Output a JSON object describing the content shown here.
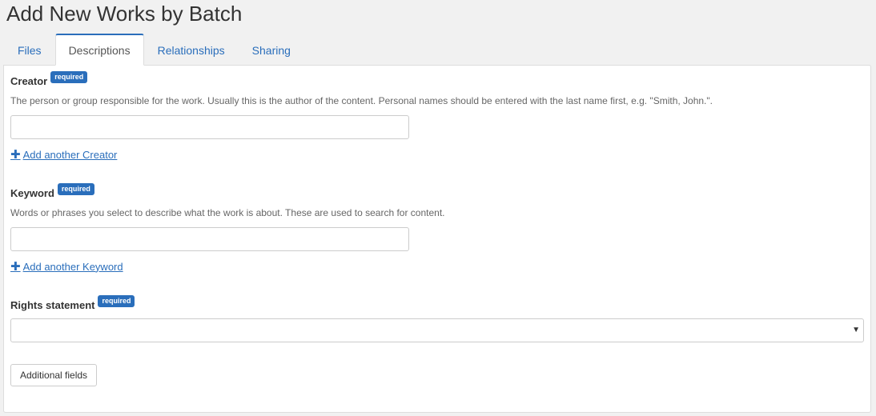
{
  "page": {
    "title": "Add New Works by Batch"
  },
  "tabs": [
    {
      "label": "Files",
      "active": false
    },
    {
      "label": "Descriptions",
      "active": true
    },
    {
      "label": "Relationships",
      "active": false
    },
    {
      "label": "Sharing",
      "active": false
    }
  ],
  "form": {
    "required_badge": "required",
    "creator": {
      "label": "Creator",
      "help": "The person or group responsible for the work. Usually this is the author of the content. Personal names should be entered with the last name first, e.g. \"Smith, John.\".",
      "value": "",
      "add_link": "Add another Creator"
    },
    "keyword": {
      "label": "Keyword",
      "help": "Words or phrases you select to describe what the work is about. These are used to search for content.",
      "value": "",
      "add_link": "Add another Keyword"
    },
    "rights": {
      "label": "Rights statement",
      "selected": ""
    },
    "additional_fields_button": "Additional fields"
  },
  "colors": {
    "accent": "#2a6ebb",
    "badge": "#2a6ebb"
  },
  "icons": {
    "add": "plus-icon",
    "select": "caret-down-icon"
  }
}
